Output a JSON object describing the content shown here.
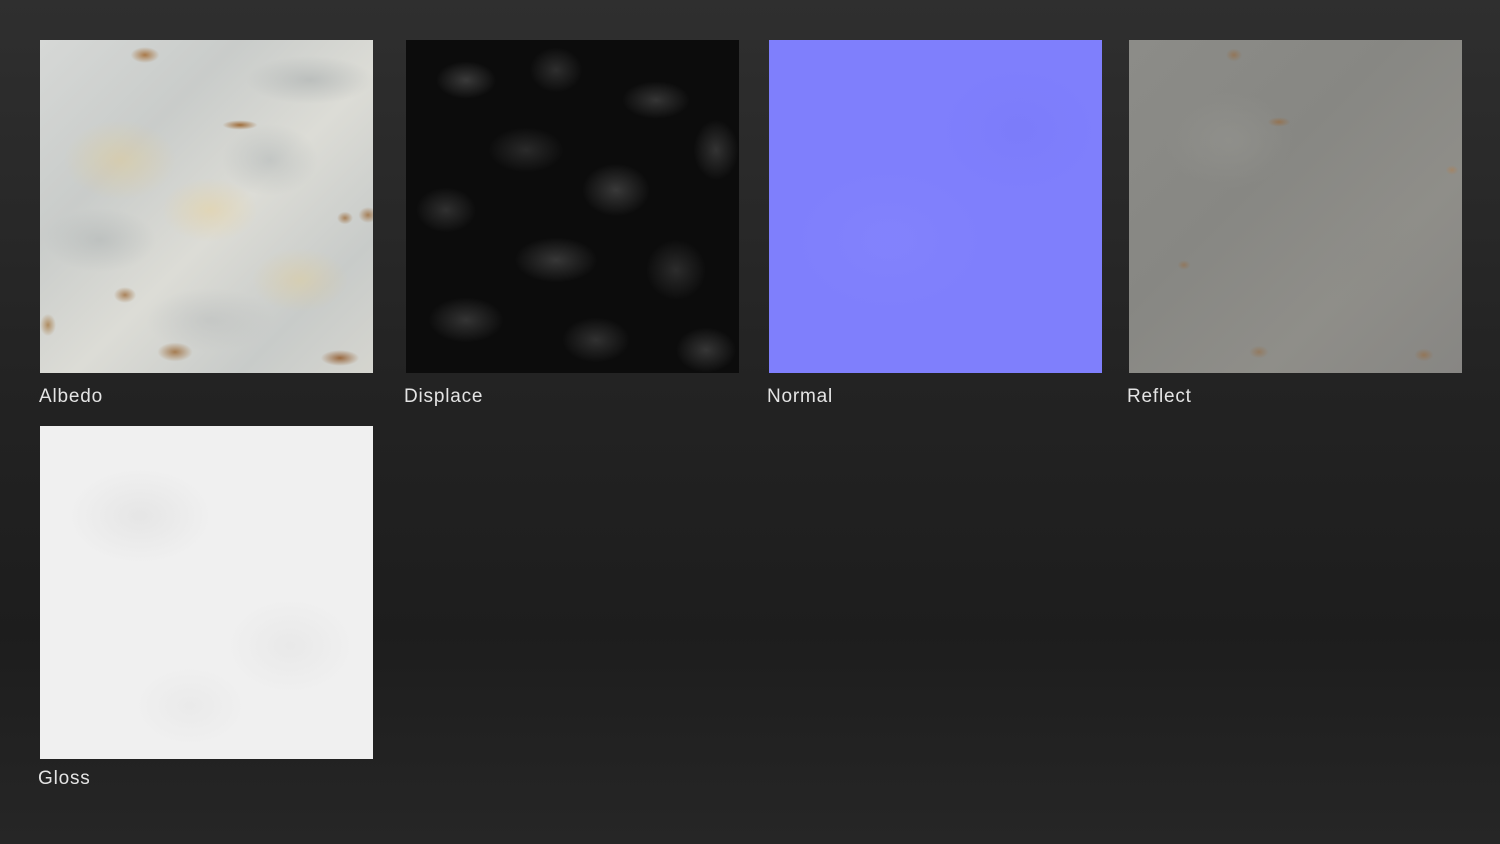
{
  "textures": [
    {
      "label": "Albedo",
      "color": "#d2d4d0"
    },
    {
      "label": "Displace",
      "color": "#0c0c0c"
    },
    {
      "label": "Normal",
      "color": "#7f7ffc"
    },
    {
      "label": "Reflect",
      "color": "#8a8a86"
    },
    {
      "label": "Gloss",
      "color": "#f0f0f0"
    }
  ]
}
